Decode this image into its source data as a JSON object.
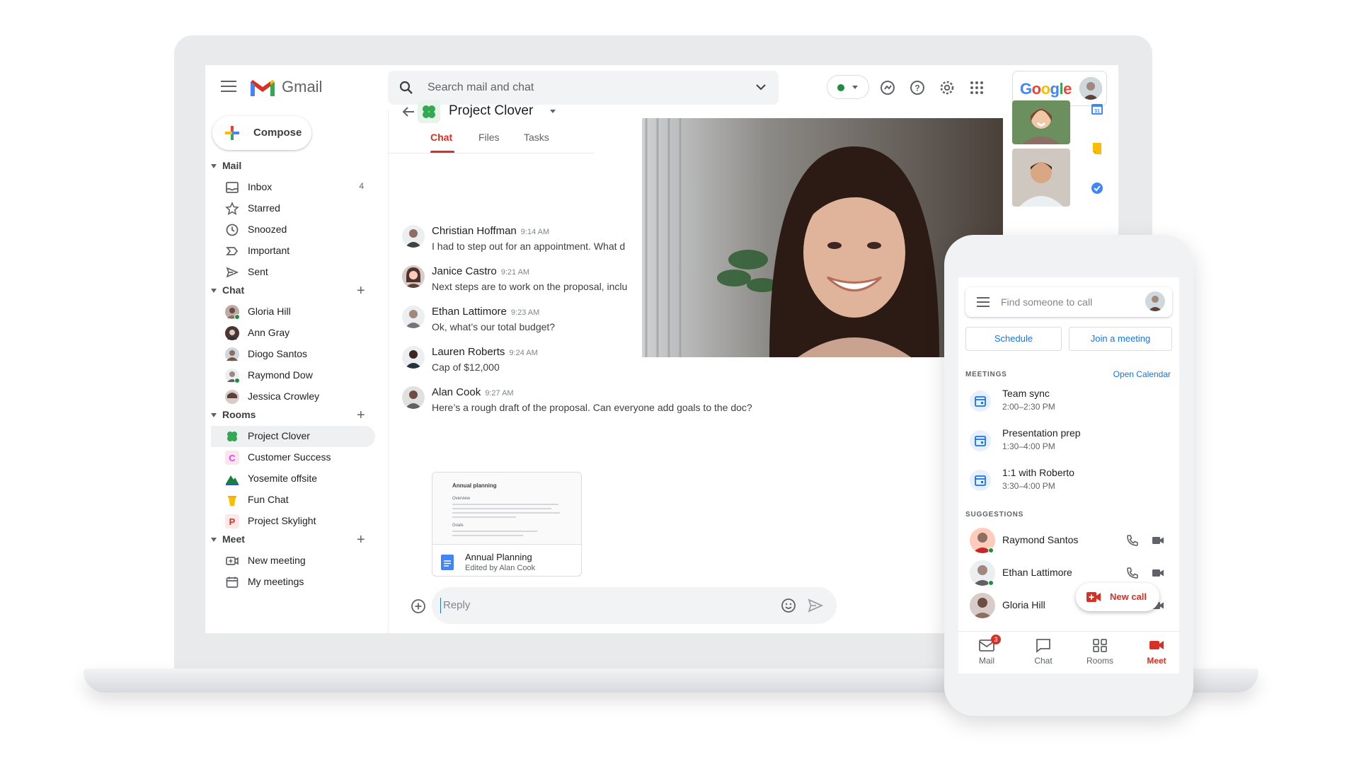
{
  "header": {
    "app_name": "Gmail",
    "search_placeholder": "Search mail and chat",
    "google_label": "Google"
  },
  "sidebar": {
    "compose_label": "Compose",
    "mail_section": "Mail",
    "mail_items": [
      {
        "label": "Inbox",
        "count": "4",
        "icon": "inbox-icon"
      },
      {
        "label": "Starred",
        "count": "",
        "icon": "star-icon"
      },
      {
        "label": "Snoozed",
        "count": "",
        "icon": "clock-icon"
      },
      {
        "label": "Important",
        "count": "",
        "icon": "important-icon"
      },
      {
        "label": "Sent",
        "count": "",
        "icon": "send-icon"
      }
    ],
    "chat_section": "Chat",
    "chat_items": [
      {
        "label": "Gloria Hill",
        "online": true
      },
      {
        "label": "Ann Gray",
        "online": false
      },
      {
        "label": "Diogo Santos",
        "online": false
      },
      {
        "label": "Raymond Dow",
        "online": true
      },
      {
        "label": "Jessica Crowley",
        "online": false
      }
    ],
    "rooms_section": "Rooms",
    "room_items": [
      {
        "label": "Project Clover",
        "letter": "",
        "color": "#34a853",
        "active": true
      },
      {
        "label": "Customer Success",
        "letter": "C",
        "color": "#e040fb",
        "active": false
      },
      {
        "label": "Yosemite offsite",
        "letter": "",
        "color": "#188038",
        "active": false
      },
      {
        "label": "Fun Chat",
        "letter": "",
        "color": "#f9ab00",
        "active": false
      },
      {
        "label": "Project Skylight",
        "letter": "P",
        "color": "#d93025",
        "active": false
      }
    ],
    "meet_section": "Meet",
    "meet_items": [
      {
        "label": "New meeting",
        "icon": "video-plus-icon"
      },
      {
        "label": "My meetings",
        "icon": "calendar-icon"
      }
    ]
  },
  "room": {
    "name": "Project Clover",
    "tabs": [
      {
        "label": "Chat",
        "active": true
      },
      {
        "label": "Files",
        "active": false
      },
      {
        "label": "Tasks",
        "active": false
      }
    ]
  },
  "messages": [
    {
      "author": "Christian Hoffman",
      "time": "9:14 AM",
      "text": "I had to step out for an appointment. What d"
    },
    {
      "author": "Janice Castro",
      "time": "9:21 AM",
      "text": "Next steps are to work on the proposal, inclu"
    },
    {
      "author": "Ethan Lattimore",
      "time": "9:23 AM",
      "text": "Ok, what’s our total budget?"
    },
    {
      "author": "Lauren Roberts",
      "time": "9:24 AM",
      "text": "Cap of $12,000"
    },
    {
      "author": "Alan Cook",
      "time": "9:27 AM",
      "text": "Here’s a rough draft of the proposal. Can everyone add goals to the doc?"
    }
  ],
  "attachment": {
    "preview_title": "Annual planning",
    "preview_overview": "Overview",
    "preview_goals": "Goals",
    "title": "Annual Planning",
    "subtitle": "Edited by Alan Cook"
  },
  "reply": {
    "placeholder": "Reply"
  },
  "phone": {
    "search_placeholder": "Find someone to call",
    "schedule_label": "Schedule",
    "join_label": "Join a meeting",
    "meetings_heading": "MEETINGS",
    "open_calendar": "Open Calendar",
    "meetings": [
      {
        "title": "Team sync",
        "time": "2:00–2:30 PM"
      },
      {
        "title": "Presentation prep",
        "time": "1:30–4:00 PM"
      },
      {
        "title": "1:1 with Roberto",
        "time": "3:30–4:00 PM"
      }
    ],
    "suggestions_heading": "SUGGESTIONS",
    "suggestions": [
      {
        "name": "Raymond Santos"
      },
      {
        "name": "Ethan Lattimore"
      },
      {
        "name": "Gloria Hill"
      }
    ],
    "new_call_label": "New call",
    "nav": [
      {
        "label": "Mail",
        "badge": "3",
        "active": false
      },
      {
        "label": "Chat",
        "badge": "",
        "active": false
      },
      {
        "label": "Rooms",
        "badge": "",
        "active": false
      },
      {
        "label": "Meet",
        "badge": "",
        "active": true
      }
    ]
  },
  "colors": {
    "accent_red": "#d93025",
    "accent_blue": "#1a73e8",
    "presence_green": "#1e8e3e"
  }
}
